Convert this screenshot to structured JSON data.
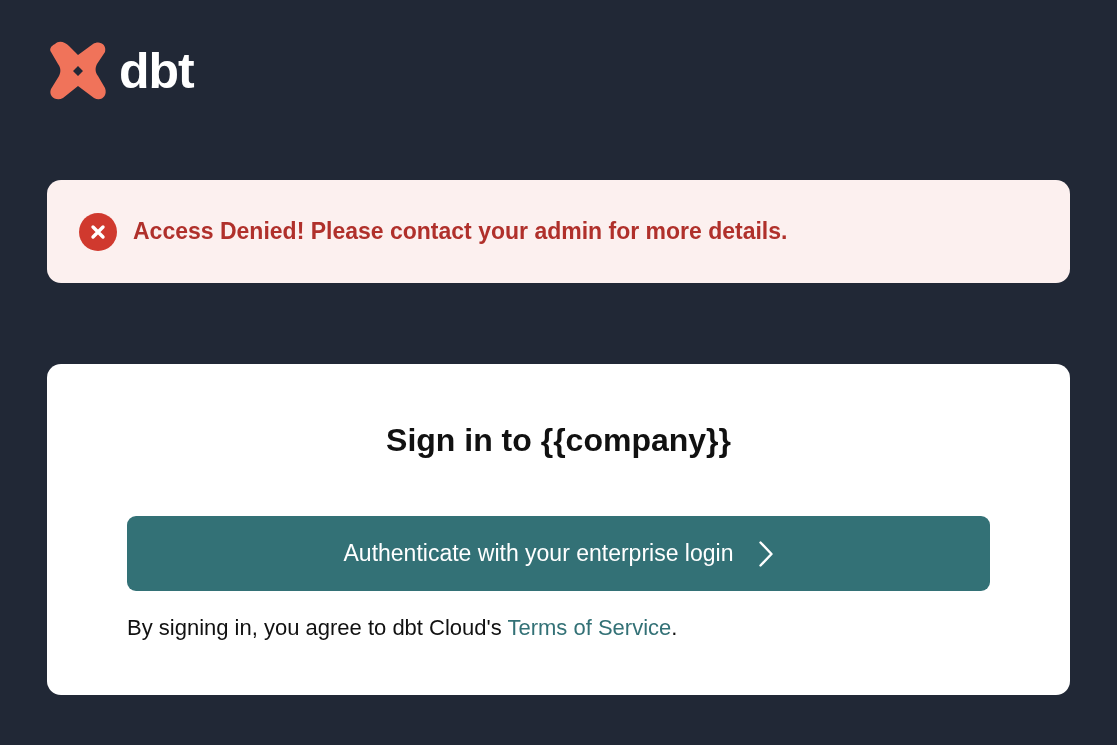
{
  "logo": {
    "text": "dbt"
  },
  "alert": {
    "kind": "error",
    "message": "Access Denied! Please contact your admin for more details."
  },
  "signin": {
    "title": "Sign in to {{company}}",
    "button": {
      "label": "Authenticate with your enterprise login"
    },
    "terms": {
      "prefix": "By signing in, you agree to dbt Cloud's ",
      "link": "Terms of Service",
      "suffix": "."
    }
  }
}
